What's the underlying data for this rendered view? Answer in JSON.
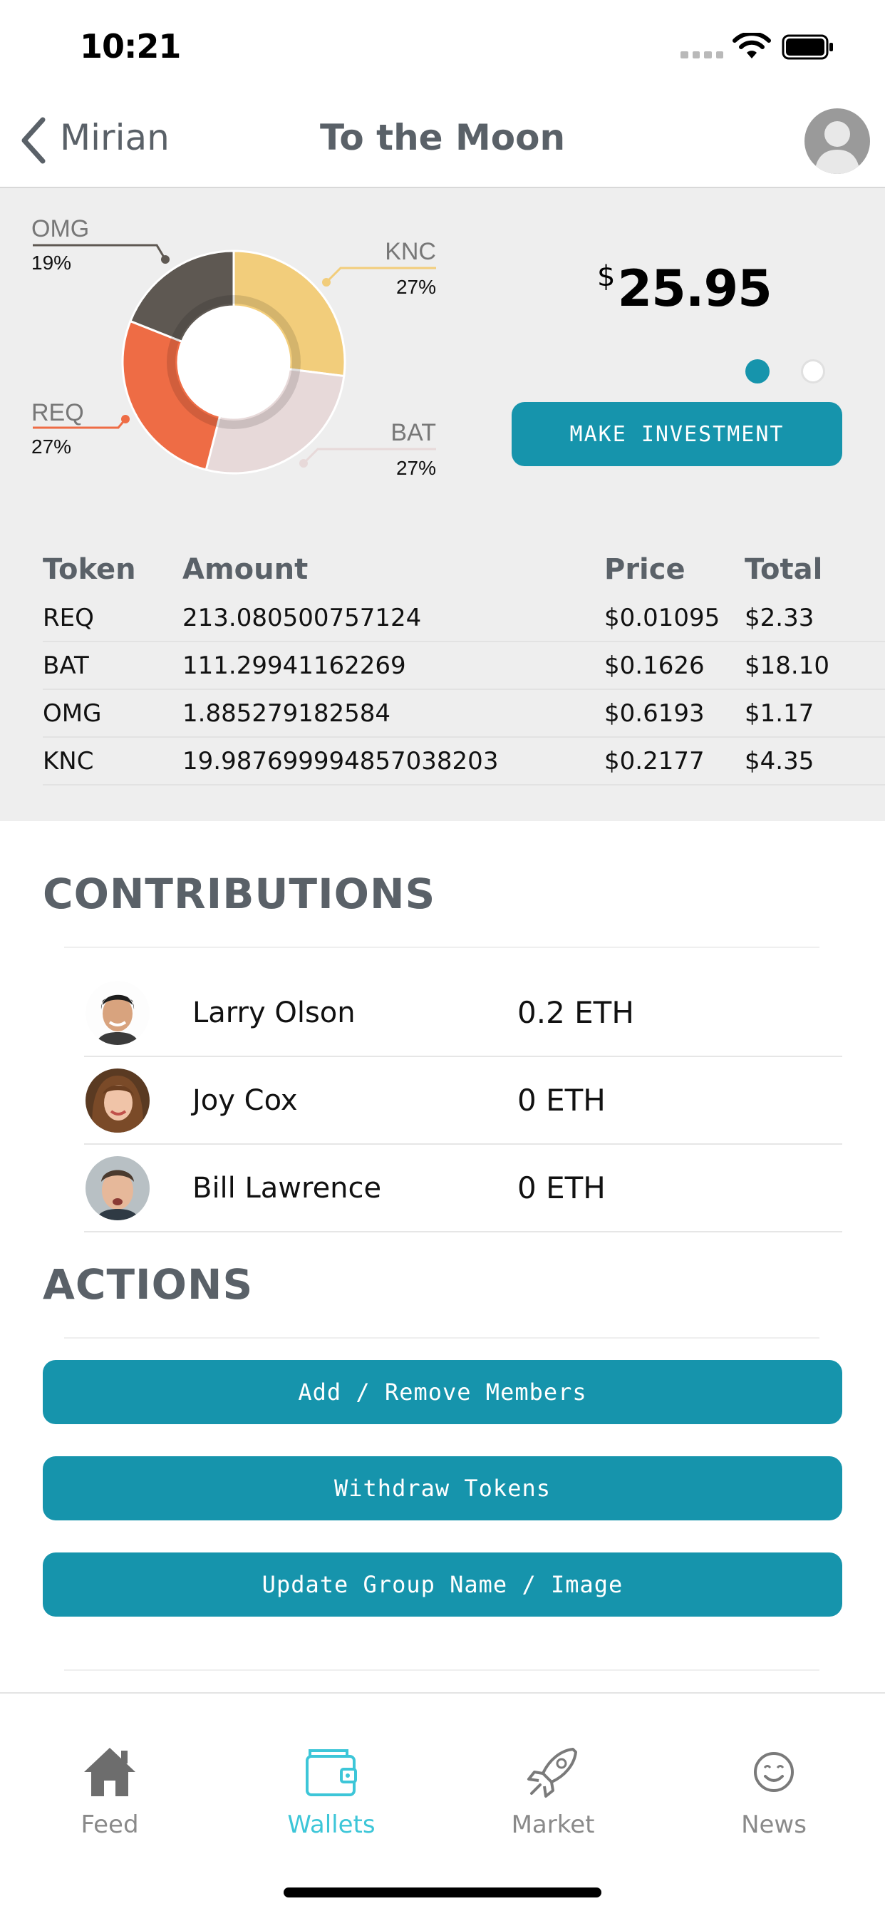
{
  "status_bar": {
    "time": "10:21"
  },
  "nav": {
    "back_label": "Mirian",
    "title": "To the Moon"
  },
  "portfolio": {
    "currency_symbol": "$",
    "balance": "25.95",
    "invest_button": "MAKE INVESTMENT",
    "chart_data": {
      "type": "pie",
      "slices": [
        {
          "label": "KNC",
          "percent_label": "27%",
          "value": 27,
          "color": "#f2cd7b"
        },
        {
          "label": "BAT",
          "percent_label": "27%",
          "value": 27,
          "color": "#e7d9d9"
        },
        {
          "label": "REQ",
          "percent_label": "27%",
          "value": 27,
          "color": "#ee6c45"
        },
        {
          "label": "OMG",
          "percent_label": "19%",
          "value": 19,
          "color": "#5e5852"
        }
      ]
    },
    "table": {
      "headers": {
        "token": "Token",
        "amount": "Amount",
        "price": "Price",
        "total": "Total"
      },
      "rows": [
        {
          "token": "REQ",
          "amount": "213.080500757124",
          "price": "$0.01095",
          "total": "$2.33"
        },
        {
          "token": "BAT",
          "amount": "111.29941162269",
          "price": "$0.1626",
          "total": "$18.10"
        },
        {
          "token": "OMG",
          "amount": "1.885279182584",
          "price": "$0.6193",
          "total": "$1.17"
        },
        {
          "token": "KNC",
          "amount": "19.987699994857038203",
          "price": "$0.2177",
          "total": "$4.35"
        }
      ]
    }
  },
  "contributions": {
    "title": "CONTRIBUTIONS",
    "items": [
      {
        "name": "Larry Olson",
        "amount": "0.2 ETH"
      },
      {
        "name": "Joy Cox",
        "amount": "0 ETH"
      },
      {
        "name": "Bill Lawrence",
        "amount": "0 ETH"
      }
    ]
  },
  "actions": {
    "title": "ACTIONS",
    "buttons": [
      "Add / Remove Members",
      "Withdraw Tokens",
      "Update Group Name / Image"
    ]
  },
  "tab_bar": {
    "tabs": [
      {
        "label": "Feed",
        "icon": "home-icon"
      },
      {
        "label": "Wallets",
        "icon": "wallet-icon"
      },
      {
        "label": "Market",
        "icon": "rocket-icon"
      },
      {
        "label": "News",
        "icon": "smiley-icon"
      }
    ],
    "active": "Wallets"
  },
  "colors": {
    "accent": "#1694ac",
    "active_tab": "#3dc6d8",
    "heading": "#5a6168",
    "panel_bg": "#eeeeee"
  }
}
